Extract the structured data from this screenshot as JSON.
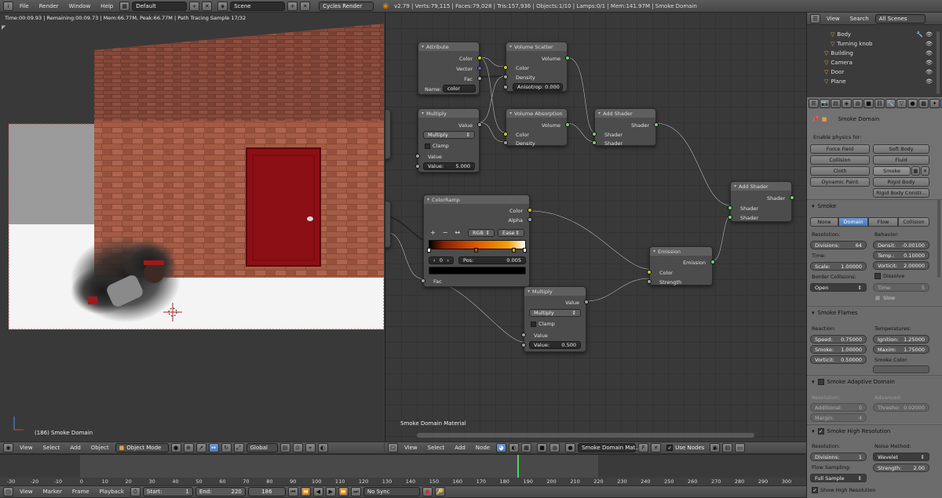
{
  "topbar": {
    "menus": [
      "File",
      "Render",
      "Window",
      "Help"
    ],
    "layout": "Default",
    "scene": "Scene",
    "engine": "Cycles Render",
    "stats": "v2.79 | Verts:79,115 | Faces:79,028 | Tris:157,936 | Objects:1/10 | Lamps:0/1 | Mem:141.97M | Smoke Domain"
  },
  "viewport": {
    "status": "Time:00:09.93 | Remaining:00:09.73 | Mem:66.77M, Peak:66.77M | Path Tracing Sample 17/32",
    "object_label": "(186) Smoke Domain",
    "header": {
      "view": "View",
      "select": "Select",
      "add": "Add",
      "object": "Object",
      "mode": "Object Mode",
      "orientation": "Global"
    }
  },
  "nodes": {
    "attribute": {
      "title": "Attribute",
      "out_color": "Color",
      "out_vector": "Vector",
      "out_fac": "Fac",
      "name_label": "Name:",
      "name_value": "color"
    },
    "vscatter": {
      "title": "Volume Scatter",
      "out": "Volume",
      "in_color": "Color",
      "in_density": "Density",
      "aniso": "Anisotrop: 0.000"
    },
    "multiply1": {
      "title": "Multiply",
      "out": "Value",
      "op": "Multiply",
      "clamp": "Clamp",
      "in_value": "Value",
      "value": "Value:",
      "value_num": "5.000"
    },
    "vabsorb": {
      "title": "Volume Absorption",
      "out": "Volume",
      "in_color": "Color",
      "in_density": "Density"
    },
    "addshader1": {
      "title": "Add Shader",
      "out": "Shader",
      "in1": "Shader",
      "in2": "Shader"
    },
    "addshader2": {
      "title": "Add Shader",
      "out": "Shader",
      "in1": "Shader",
      "in2": "Shader"
    },
    "colorramp": {
      "title": "ColorRamp",
      "out_color": "Color",
      "out_alpha": "Alpha",
      "plus": "+",
      "minus": "−",
      "flip": "↔",
      "mode": "RGB",
      "interp": "Ease",
      "index": "0",
      "pos": "Pos:",
      "pos_value": "0.005",
      "in_fac": "Fac"
    },
    "emission": {
      "title": "Emission",
      "out": "Emission",
      "in_color": "Color",
      "in_strength": "Strength"
    },
    "multiply2": {
      "title": "Multiply",
      "out": "Value",
      "op": "Multiply",
      "clamp": "Clamp",
      "in_value": "Value",
      "value": "Value:",
      "value_num": "0.500"
    },
    "material_label": "Smoke Domain Material"
  },
  "node_header": {
    "view": "View",
    "select": "Select",
    "add": "Add",
    "node": "Node",
    "material": "Smoke Domain Mat...",
    "f": "F",
    "use_nodes": "Use Nodes"
  },
  "outliner": {
    "view": "View",
    "search": "Search",
    "filter": "All Scenes",
    "items": [
      "Body",
      "Turning knob",
      "Building",
      "Camera",
      "Door",
      "Plane"
    ]
  },
  "properties": {
    "object": "Smoke Domain",
    "enable": "Enable physics for:",
    "physics": [
      "Force Field",
      "Soft Body",
      "Collision",
      "Fluid",
      "Cloth",
      "Smoke",
      "Dynamic Paint",
      "Rigid Body",
      "Rigid Body Constr..."
    ],
    "smoke": {
      "header": "Smoke",
      "tabs": [
        "None",
        "Domain",
        "Flow",
        "Collision"
      ],
      "resolution": "Resolution:",
      "divisions_label": "Divisions:",
      "divisions": "64",
      "time": "Time:",
      "scale_label": "Scale:",
      "scale": "1.00000",
      "border": "Border Collisions:",
      "border_val": "Open",
      "behavior": "Behavior:",
      "density_label": "Densit:",
      "density": "-0.00100",
      "temp_label": "Temp.:",
      "temp": "0.10000",
      "vort_label": "Vorticit:",
      "vort": "2.00000",
      "dissolve": "Dissolve",
      "time2_label": "Time:",
      "time2": "5",
      "slow": "Slow"
    },
    "flames": {
      "header": "Smoke Flames",
      "reaction": "Reaction:",
      "speed_label": "Speed:",
      "speed": "0.75000",
      "smoke_label": "Smoke:",
      "smoke": "1.00000",
      "vort_label": "Vorticit:",
      "vort": "0.50000",
      "temps": "Temperatures:",
      "ign_label": "Ignition:",
      "ign": "1.25000",
      "max_label": "Maxim:",
      "max": "1.75000",
      "color": "Smoke Color:"
    },
    "adaptive": {
      "header": "Smoke Adaptive Domain",
      "resolution": "Resolution:",
      "add_label": "Additional:",
      "add": "0",
      "margin_label": "Margin:",
      "margin": "4",
      "advanced": "Advanced:",
      "thresh_label": "Thresho:",
      "thresh": "0.02000"
    },
    "highres": {
      "header": "Smoke High Resolution",
      "resolution": "Resolution:",
      "div_label": "Divisions:",
      "div": "1",
      "noise": "Noise Method:",
      "noise_val": "Wavelet",
      "flow": "Flow Sampling:",
      "flow_val": "Full Sample",
      "strength_label": "Strength:",
      "strength": "2.00",
      "show": "Show High Resolution"
    }
  },
  "timeline": {
    "ticks": [
      "-30",
      "-20",
      "-10",
      "0",
      "10",
      "20",
      "30",
      "40",
      "50",
      "60",
      "70",
      "80",
      "90",
      "100",
      "110",
      "120",
      "130",
      "140",
      "150",
      "160",
      "170",
      "180",
      "190",
      "200",
      "210",
      "220",
      "230",
      "240",
      "250",
      "260",
      "270",
      "280",
      "290",
      "300"
    ],
    "start_label": "Start:",
    "start": "1",
    "end_label": "End:",
    "end": "220",
    "current": "186",
    "sync": "No Sync",
    "menus": [
      "View",
      "Marker",
      "Frame",
      "Playback"
    ]
  }
}
